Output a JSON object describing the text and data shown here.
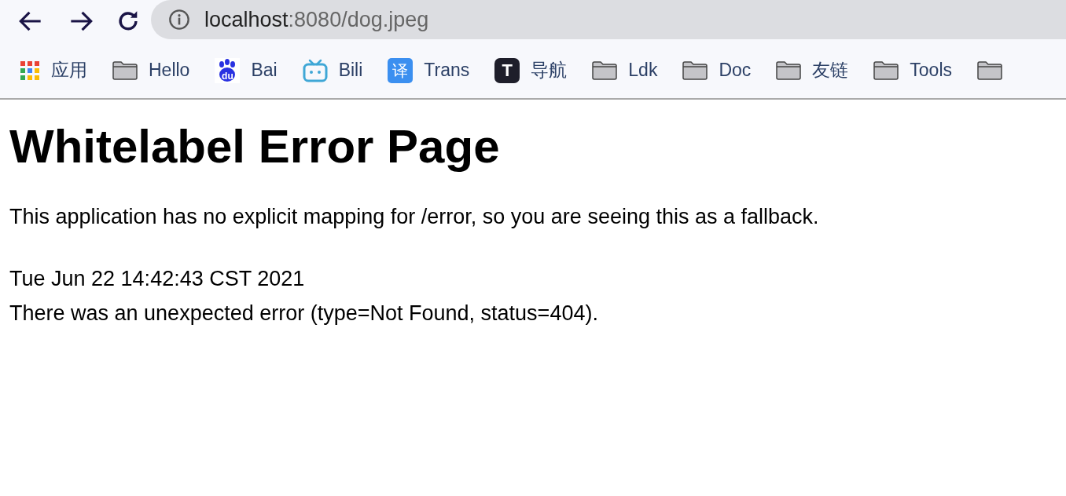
{
  "address_bar": {
    "host": "localhost",
    "path": ":8080/dog.jpeg"
  },
  "bookmarks": [
    {
      "kind": "apps",
      "label": "应用"
    },
    {
      "kind": "folder",
      "label": "Hello"
    },
    {
      "kind": "paw",
      "label": "Bai",
      "icon_text": "du"
    },
    {
      "kind": "tv",
      "label": "Bili"
    },
    {
      "kind": "badge",
      "label": "Trans",
      "icon_text": "译"
    },
    {
      "kind": "dark",
      "label": "导航",
      "icon_text": "T"
    },
    {
      "kind": "folder",
      "label": "Ldk"
    },
    {
      "kind": "folder",
      "label": "Doc"
    },
    {
      "kind": "folder",
      "label": "友链"
    },
    {
      "kind": "folder",
      "label": "Tools"
    },
    {
      "kind": "folder"
    }
  ],
  "page": {
    "heading": "Whitelabel Error Page",
    "message": "This application has no explicit mapping for /error, so you are seeing this as a fallback.",
    "timestamp": "Tue Jun 22 14:42:43 CST 2021",
    "error": "There was an unexpected error (type=Not Found, status=404)."
  }
}
